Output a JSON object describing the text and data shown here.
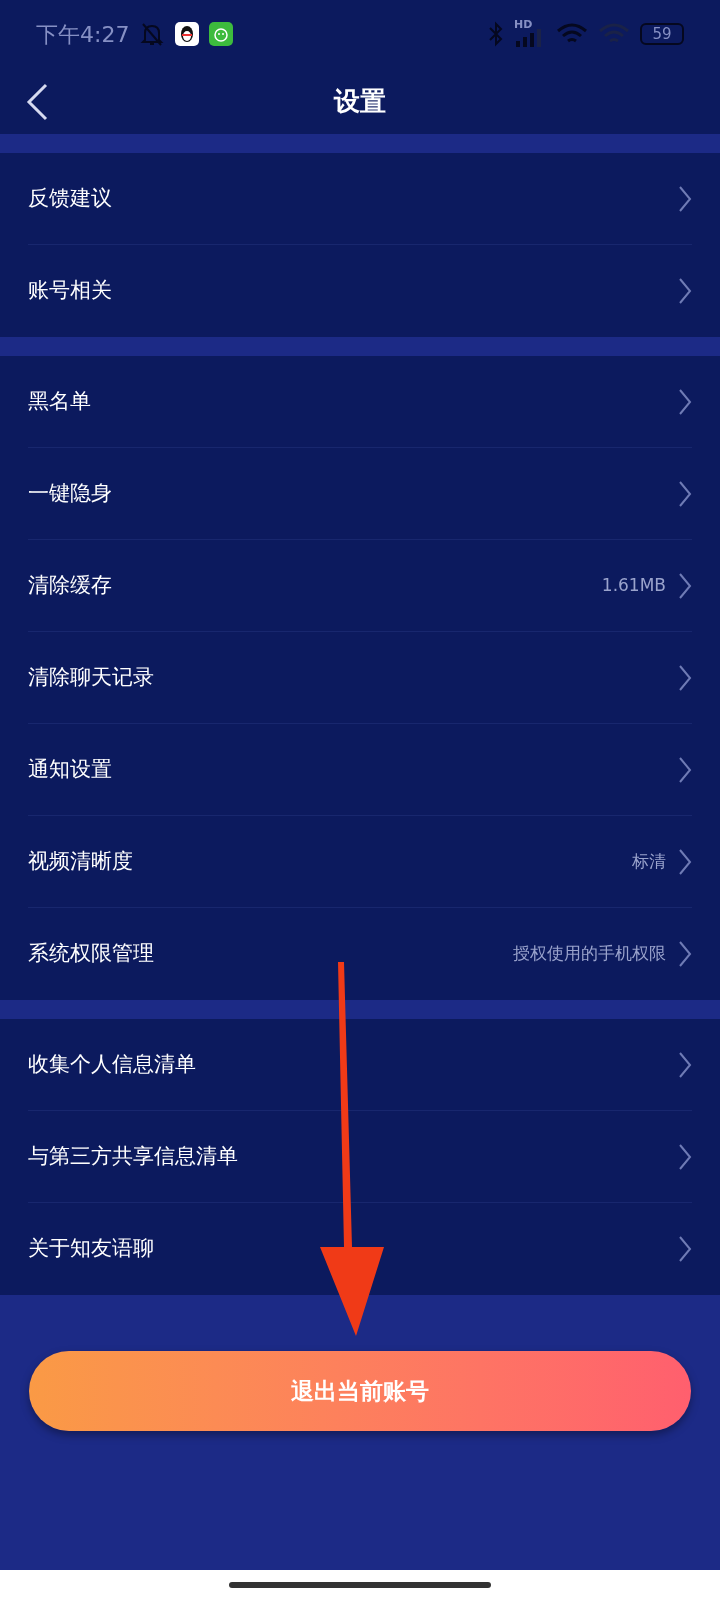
{
  "status_bar": {
    "time": "下午4:27",
    "network_label": "HD",
    "battery": "59"
  },
  "header": {
    "title": "设置"
  },
  "sections": [
    {
      "items": [
        {
          "label": "反馈建议"
        },
        {
          "label": "账号相关"
        }
      ]
    },
    {
      "items": [
        {
          "label": "黑名单"
        },
        {
          "label": "一键隐身"
        },
        {
          "label": "清除缓存",
          "value": "1.61MB"
        },
        {
          "label": "清除聊天记录"
        },
        {
          "label": "通知设置"
        },
        {
          "label": "视频清晰度",
          "value": "标清"
        },
        {
          "label": "系统权限管理",
          "value": "授权使用的手机权限"
        }
      ]
    },
    {
      "items": [
        {
          "label": "收集个人信息清单"
        },
        {
          "label": "与第三方共享信息清单"
        },
        {
          "label": "关于知友语聊"
        }
      ]
    }
  ],
  "logout_button": {
    "label": "退出当前账号"
  }
}
